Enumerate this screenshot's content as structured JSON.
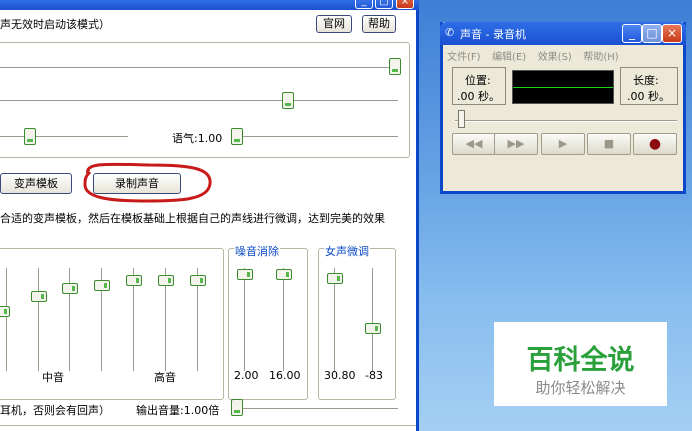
{
  "main": {
    "top_text": "声无效时启动该模式）",
    "btn_official": "官网",
    "btn_help": "帮助",
    "tone_label": "语气:1.00",
    "btn_voice_template": "变声模板",
    "btn_record": "录制声音",
    "instruction": "合适的变声模板，然后在模板基础上根据自己的声线进行微调，达到完美的效果",
    "noise_group_title": "噪音消除",
    "female_group_title": "女声微调",
    "eq_mid": "中音",
    "eq_high": "高音",
    "noise_val1": "2.00",
    "noise_val2": "16.00",
    "female_val1": "30.80",
    "female_val2": "-83",
    "bottom_text": "耳机，否则会有回声）",
    "output_label": "输出音量:1.00倍"
  },
  "recorder": {
    "title": "声音 - 录音机",
    "menu": [
      "文件(F)",
      "编辑(E)",
      "效果(S)",
      "帮助(H)"
    ],
    "position_label": "位置:",
    "position_value": ".00 秒。",
    "length_label": "长度:",
    "length_value": ".00 秒。",
    "btn_rewind": "◀◀",
    "btn_forward": "▶▶",
    "btn_play": "▶",
    "btn_stop": "■",
    "btn_record": "●"
  },
  "watermark": {
    "title": "百科全说",
    "subtitle": "助你轻松解决"
  },
  "colors": {
    "record_accent": "#8b0b10",
    "highlight_circle": "#c81a1a",
    "group_title": "#0b49c7",
    "watermark_green": "#2aa03b"
  }
}
